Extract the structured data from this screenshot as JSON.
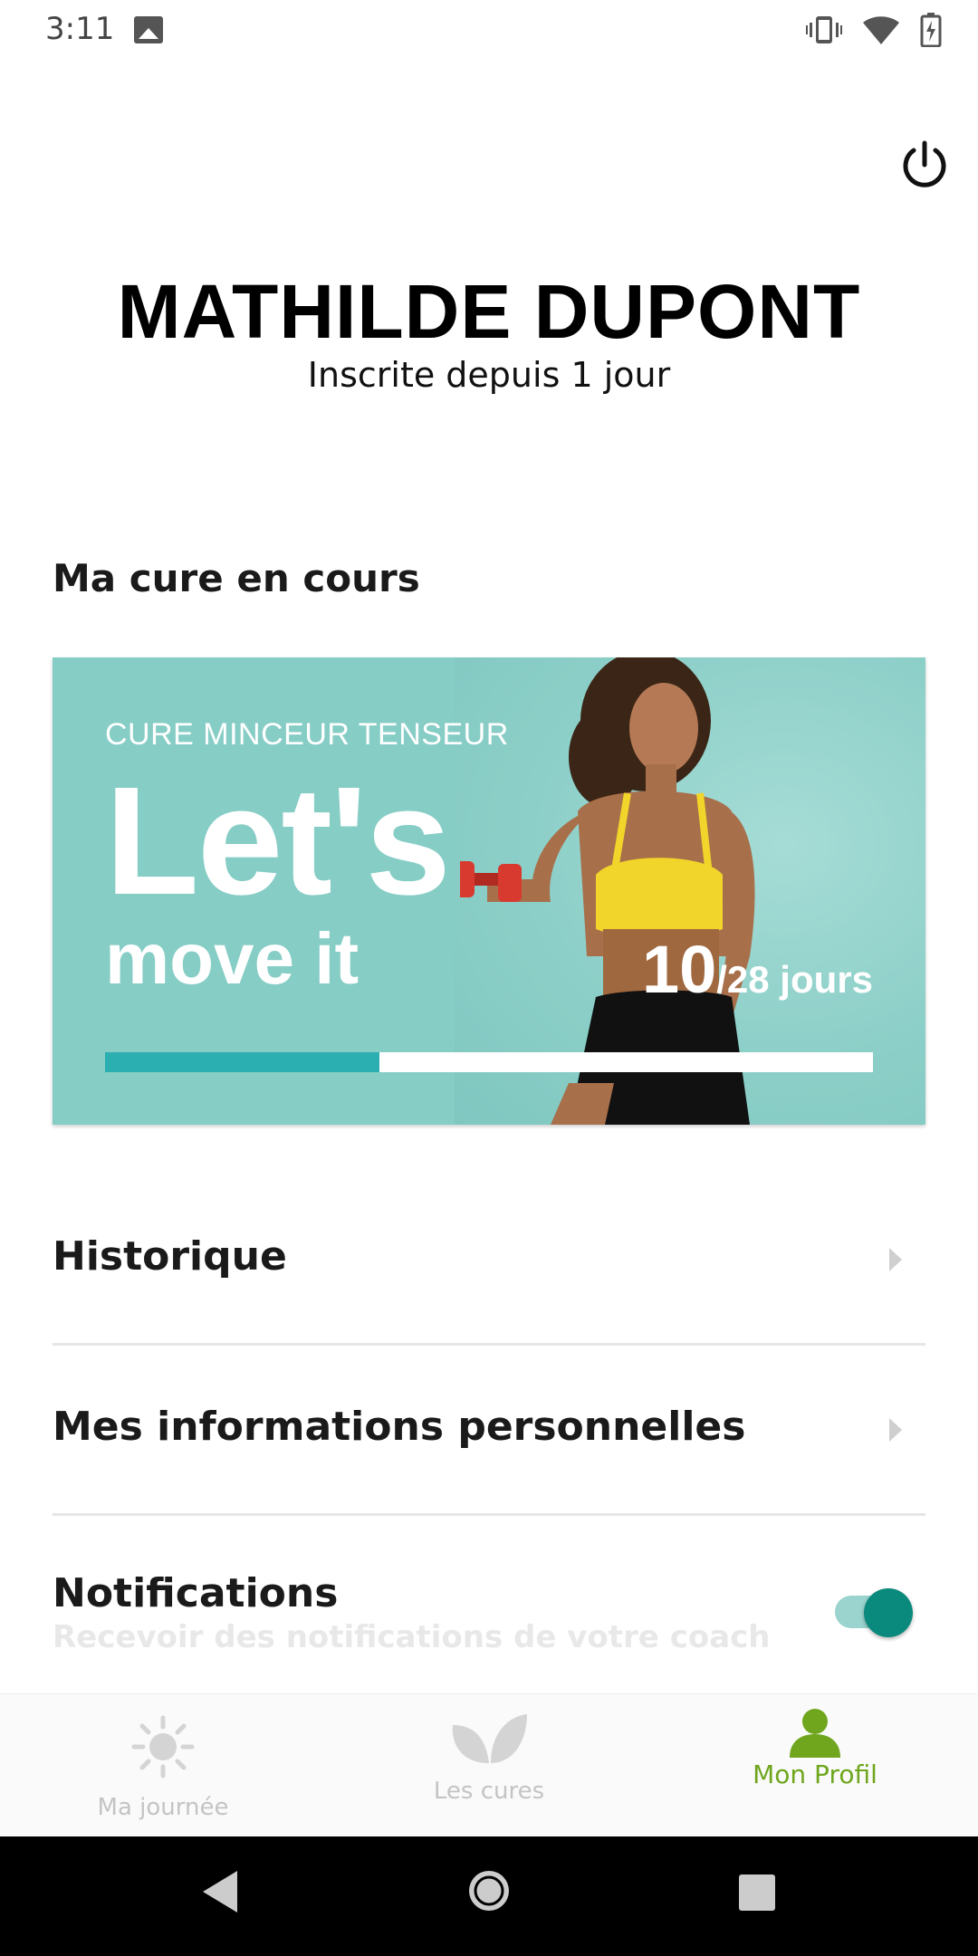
{
  "status_bar": {
    "time": "3:11",
    "icons": [
      "image-icon",
      "vibrate-icon",
      "wifi-icon",
      "battery-charging-icon"
    ]
  },
  "header": {
    "power_icon": "power-icon",
    "user_name": "MATHILDE DUPONT",
    "member_since": "Inscrite depuis 1 jour"
  },
  "current_cure": {
    "section_title": "Ma cure en cours",
    "subtitle": "CURE MINCEUR TENSEUR",
    "title_line1": "Let's",
    "title_line2": "move it",
    "progress_current": "10",
    "progress_total": "/28 jours",
    "progress_fraction": 0.357,
    "colors": {
      "card_bg": "#86cdc6",
      "progress_fill": "#2bafb0",
      "progress_track": "#ffffff"
    }
  },
  "menu": {
    "history_label": "Historique",
    "personal_info_label": "Mes informations personnelles"
  },
  "notifications": {
    "title": "Notifications",
    "subtitle": "Recevoir des notifications de votre coach",
    "enabled": true,
    "toggle_color": "#0a8a7c"
  },
  "bottom_nav": {
    "items": [
      {
        "label": "Ma journée",
        "icon": "sun-icon",
        "active": false
      },
      {
        "label": "Les cures",
        "icon": "leaf-icon",
        "active": false
      },
      {
        "label": "Mon Profil",
        "icon": "person-icon",
        "active": true
      }
    ],
    "active_color": "#6fa61e"
  },
  "system_nav": {
    "icons": [
      "back-icon",
      "home-icon",
      "recents-icon"
    ]
  }
}
